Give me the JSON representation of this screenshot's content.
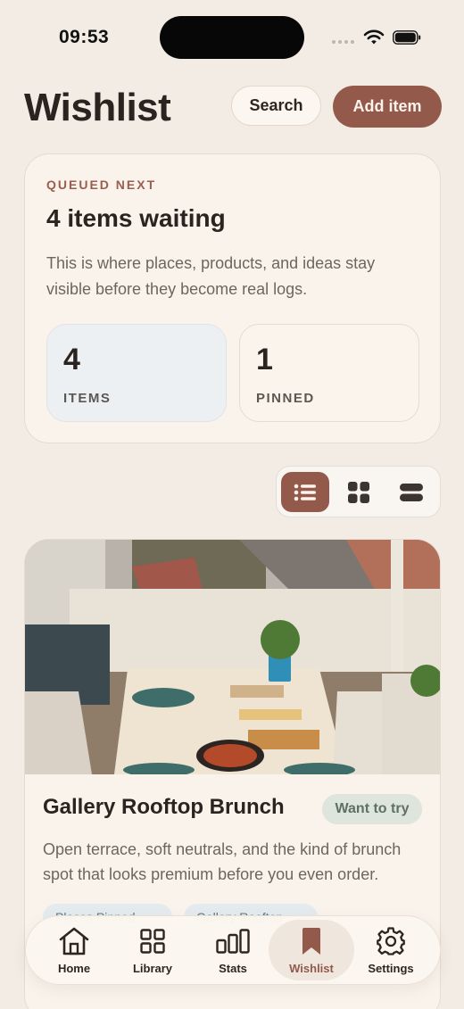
{
  "status_bar": {
    "time": "09:53"
  },
  "header": {
    "title": "Wishlist",
    "search_label": "Search",
    "add_label": "Add item"
  },
  "summary": {
    "eyebrow": "QUEUED NEXT",
    "title": "4 items waiting",
    "description": "This is where places, products, and ideas stay visible before they become real logs.",
    "stats": [
      {
        "value": "4",
        "label": "ITEMS"
      },
      {
        "value": "1",
        "label": "PINNED"
      }
    ]
  },
  "view_toggle": {
    "selected": "list",
    "options": [
      "list",
      "grid",
      "compact"
    ]
  },
  "items": [
    {
      "title": "Gallery Rooftop Brunch",
      "badge": "Want to try",
      "description": "Open terrace, soft neutrals, and the kind of brunch spot that looks premium before you even order.",
      "chips": [
        "Places Pinned",
        "Gallery Rooftop"
      ]
    }
  ],
  "tabs": [
    {
      "label": "Home",
      "icon": "home-icon",
      "active": false
    },
    {
      "label": "Library",
      "icon": "grid-icon",
      "active": false
    },
    {
      "label": "Stats",
      "icon": "bar-chart-icon",
      "active": false
    },
    {
      "label": "Wishlist",
      "icon": "bookmark-icon",
      "active": true
    },
    {
      "label": "Settings",
      "icon": "gear-icon",
      "active": false
    }
  ],
  "colors": {
    "background": "#f3ece4",
    "accent": "#93594b",
    "card": "#faf3ec",
    "badge_bg": "#dde5dc",
    "badge_text": "#5e7160"
  }
}
